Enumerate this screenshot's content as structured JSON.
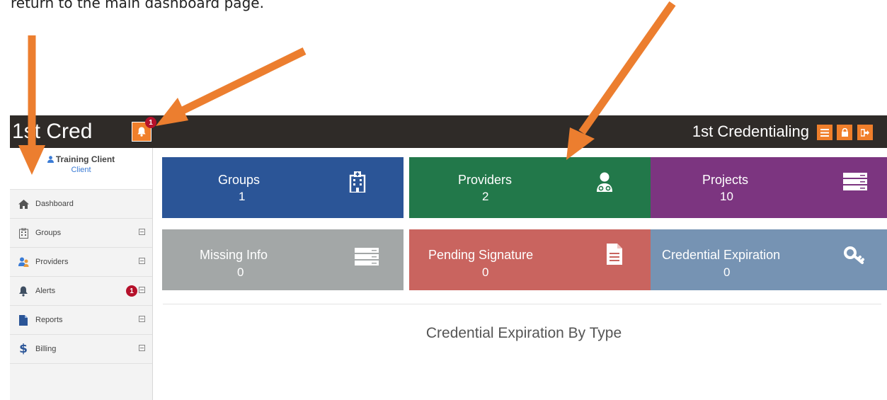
{
  "document": {
    "text": "return to the main dashboard page."
  },
  "header": {
    "brand": "1st Cred",
    "notification_count": "1",
    "company": "1st Credentialing",
    "icons": [
      "bell-icon",
      "menu-icon",
      "lock-icon",
      "logout-icon"
    ]
  },
  "profile": {
    "name": "Training Client",
    "role": "Client"
  },
  "sidebar": {
    "items": [
      {
        "label": "Dashboard",
        "icon": "home-icon"
      },
      {
        "label": "Groups",
        "icon": "building-icon"
      },
      {
        "label": "Providers",
        "icon": "users-icon"
      },
      {
        "label": "Alerts",
        "icon": "bell-icon",
        "badge": "1"
      },
      {
        "label": "Reports",
        "icon": "file-icon"
      },
      {
        "label": "Billing",
        "icon": "dollar-icon"
      }
    ]
  },
  "tiles": [
    {
      "label": "Groups",
      "count": "1",
      "color": "#2b5597",
      "icon": "hospital-icon"
    },
    {
      "label": "Providers",
      "count": "2",
      "color": "#22784a",
      "icon": "doctor-icon"
    },
    {
      "label": "Projects",
      "count": "10",
      "color": "#7c3580",
      "icon": "server-icon"
    },
    {
      "label": "Missing Info",
      "count": "0",
      "color": "#a3a7a7",
      "icon": "server-icon"
    },
    {
      "label": "Pending Signature",
      "count": "0",
      "color": "#c9645f",
      "icon": "document-icon"
    },
    {
      "label": "Credential Expiration",
      "count": "0",
      "color": "#7693b3",
      "icon": "key-icon"
    }
  ],
  "chart": {
    "title": "Credential Expiration By Type"
  },
  "colors": {
    "header_bg": "#2f2b28",
    "accent_orange": "#f07f2b",
    "badge_red": "#b5112b",
    "annotation_arrow": "#ec7e2f"
  }
}
